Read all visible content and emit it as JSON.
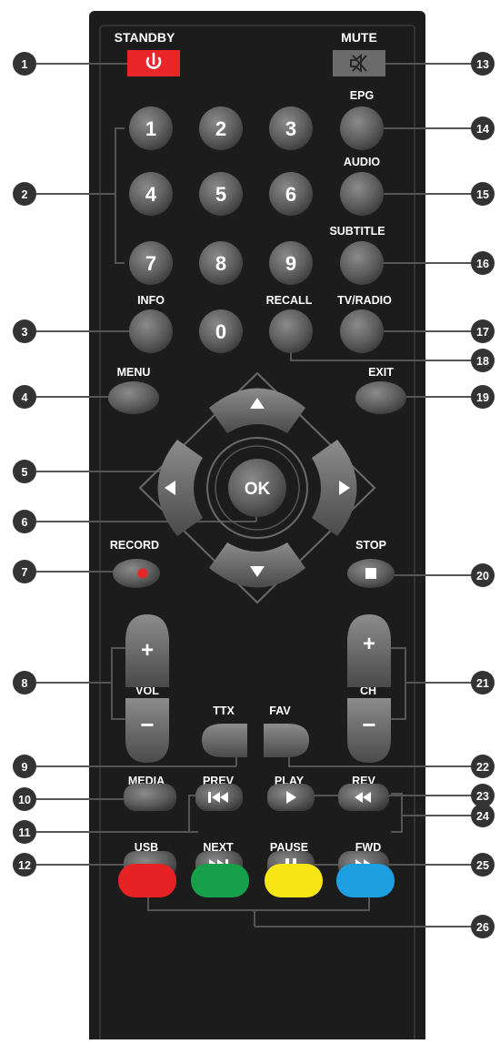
{
  "labels": {
    "standby": "STANDBY",
    "mute": "MUTE",
    "epg": "EPG",
    "audio": "AUDIO",
    "subtitle": "SUBTITLE",
    "info": "INFO",
    "recall": "RECALL",
    "tv_radio": "TV/RADIO",
    "menu": "MENU",
    "exit": "EXIT",
    "record": "RECORD",
    "stop": "STOP",
    "vol": "VOL",
    "ch": "CH",
    "ttx": "TTX",
    "fav": "FAV",
    "media": "MEDIA",
    "prev": "PREV",
    "play": "PLAY",
    "rev": "REV",
    "usb": "USB",
    "next": "NEXT",
    "pause": "PAUSE",
    "fwd": "FWD"
  },
  "button_text": {
    "ok": "OK",
    "plus": "+",
    "minus": "−"
  },
  "digits": [
    "1",
    "2",
    "3",
    "4",
    "5",
    "6",
    "7",
    "8",
    "9",
    "0"
  ],
  "callouts": [
    "1",
    "2",
    "3",
    "4",
    "5",
    "6",
    "7",
    "8",
    "9",
    "10",
    "11",
    "12",
    "13",
    "14",
    "15",
    "16",
    "17",
    "18",
    "19",
    "20",
    "21",
    "22",
    "23",
    "24",
    "25",
    "26"
  ],
  "colors": {
    "remote_body": "#1c1c1c",
    "button": "#666666",
    "standby_red": "#e8262a",
    "record_dot": "#e8262a",
    "color_red": "#e62225",
    "color_green": "#17a04a",
    "color_yellow": "#f7e516",
    "color_blue": "#1d9fe2",
    "callout": "#333333"
  }
}
